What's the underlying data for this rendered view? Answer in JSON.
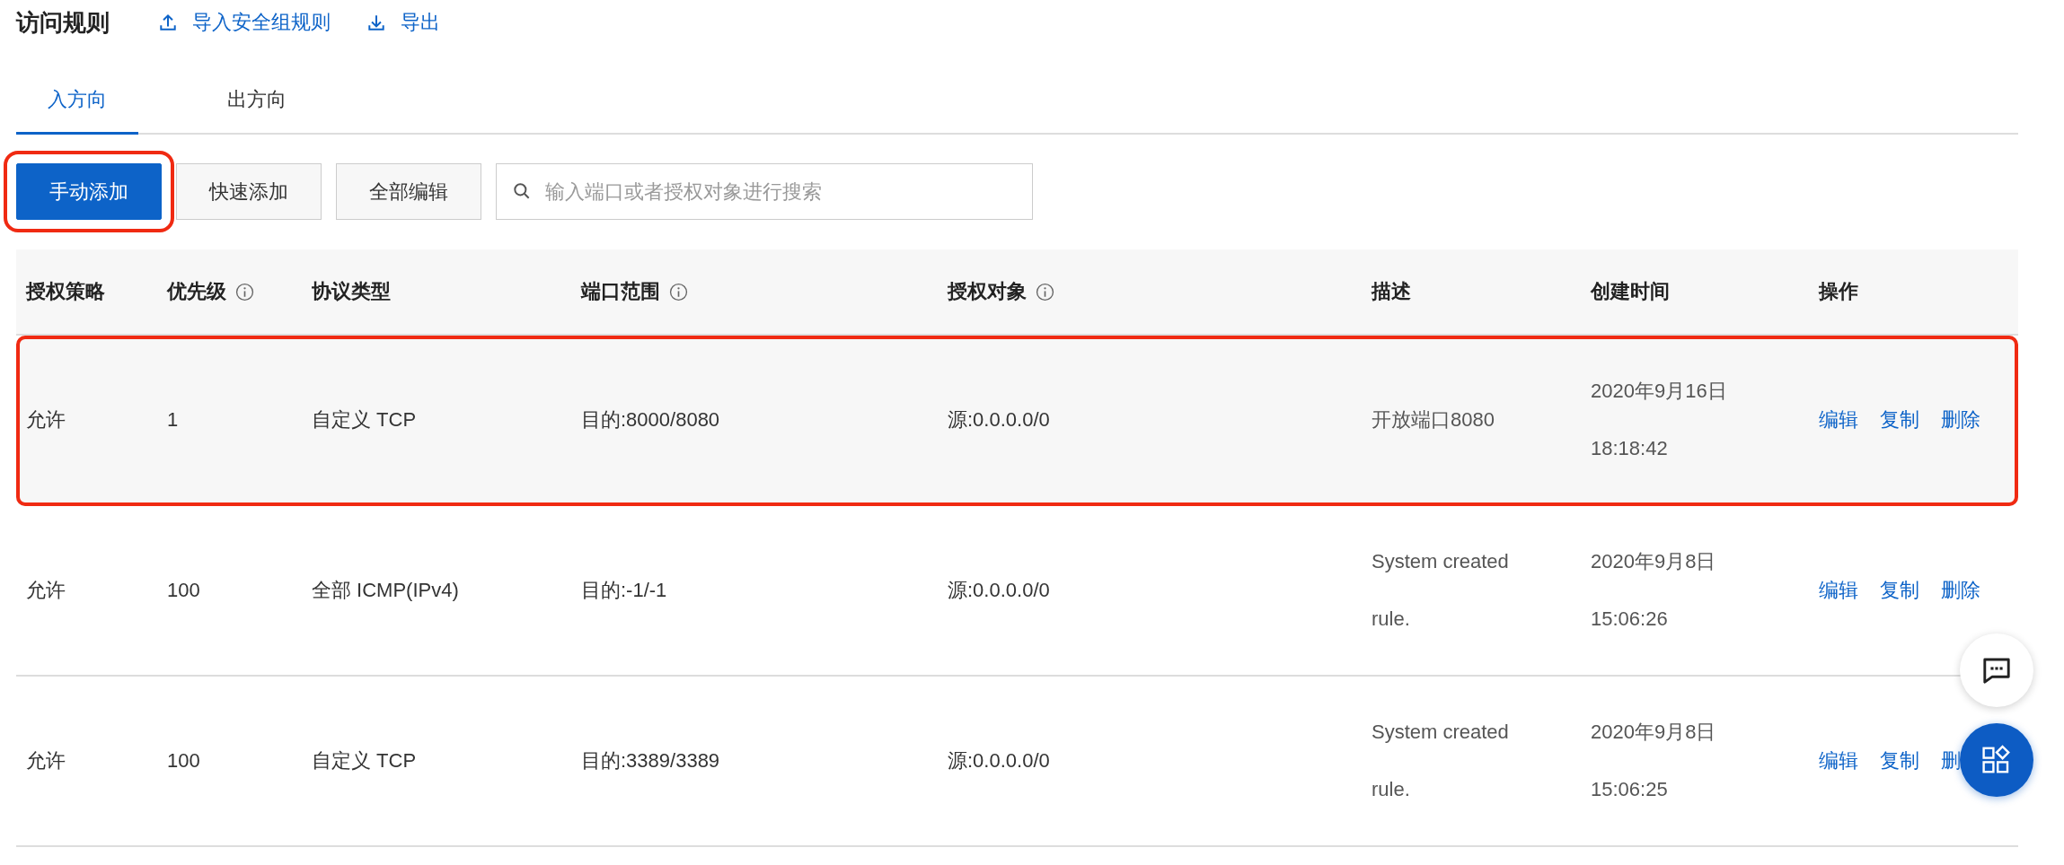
{
  "header": {
    "title": "访问规则",
    "actions": [
      {
        "label": "导入安全组规则",
        "kind": "upload"
      },
      {
        "label": "导出",
        "kind": "download"
      }
    ]
  },
  "tabs": [
    {
      "label": "入方向",
      "selected": true
    },
    {
      "label": "出方向",
      "selected": false
    }
  ],
  "toolbar": {
    "buttons": [
      {
        "label": "手动添加",
        "kind": "primary",
        "highlighted": true
      },
      {
        "label": "快速添加",
        "kind": "default",
        "highlighted": false
      },
      {
        "label": "全部编辑",
        "kind": "default",
        "highlighted": false
      }
    ],
    "search": {
      "placeholder": "输入端口或者授权对象进行搜索"
    }
  },
  "table": {
    "columns": [
      {
        "label": "授权策略",
        "info": false
      },
      {
        "label": "优先级",
        "info": true
      },
      {
        "label": "协议类型",
        "info": false
      },
      {
        "label": "端口范围",
        "info": true
      },
      {
        "label": "授权对象",
        "info": true
      },
      {
        "label": "描述",
        "info": false
      },
      {
        "label": "创建时间",
        "info": false
      },
      {
        "label": "操作",
        "info": false
      }
    ],
    "rows": [
      {
        "highlighted": true,
        "cells": [
          "允许",
          "1",
          "自定义 TCP",
          "目的:8000/8080",
          "源:0.0.0.0/0",
          "开放端口8080",
          "2020年9月16日 18:18:42"
        ],
        "actions": [
          "编辑",
          "复制",
          "删除"
        ]
      },
      {
        "highlighted": false,
        "cells": [
          "允许",
          "100",
          "全部 ICMP(IPv4)",
          "目的:-1/-1",
          "源:0.0.0.0/0",
          "System created rule.",
          "2020年9月8日 15:06:26"
        ],
        "actions": [
          "编辑",
          "复制",
          "删除"
        ]
      },
      {
        "highlighted": false,
        "cells": [
          "允许",
          "100",
          "自定义 TCP",
          "目的:3389/3389",
          "源:0.0.0.0/0",
          "System created rule.",
          "2020年9月8日 15:06:25"
        ],
        "actions": [
          "编辑",
          "复制",
          "删"
        ]
      }
    ]
  },
  "floating_buttons": [
    {
      "kind": "chat"
    },
    {
      "kind": "apps"
    }
  ]
}
